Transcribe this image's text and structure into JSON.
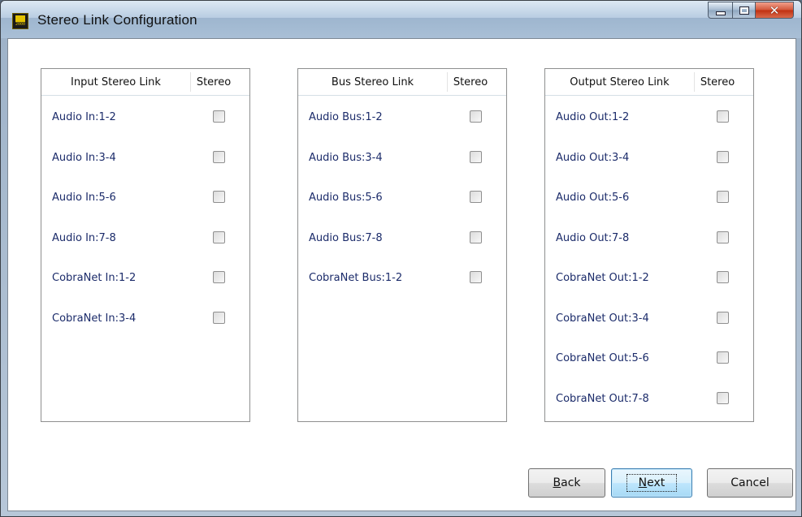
{
  "window": {
    "title": "Stereo Link Configuration",
    "icon_name": "app-logo-icon",
    "accent_color": "#1b2b6a"
  },
  "panels": [
    {
      "header": "Input Stereo Link",
      "stereo_header": "Stereo",
      "rows": [
        {
          "label": "Audio In:1-2",
          "checked": false
        },
        {
          "label": "Audio In:3-4",
          "checked": false
        },
        {
          "label": "Audio In:5-6",
          "checked": false
        },
        {
          "label": "Audio In:7-8",
          "checked": false
        },
        {
          "label": "CobraNet In:1-2",
          "checked": false
        },
        {
          "label": "CobraNet In:3-4",
          "checked": false
        }
      ]
    },
    {
      "header": "Bus Stereo Link",
      "stereo_header": "Stereo",
      "rows": [
        {
          "label": "Audio Bus:1-2",
          "checked": false
        },
        {
          "label": "Audio Bus:3-4",
          "checked": false
        },
        {
          "label": "Audio Bus:5-6",
          "checked": false
        },
        {
          "label": "Audio Bus:7-8",
          "checked": false
        },
        {
          "label": "CobraNet Bus:1-2",
          "checked": false
        }
      ]
    },
    {
      "header": "Output Stereo Link",
      "stereo_header": "Stereo",
      "rows": [
        {
          "label": "Audio Out:1-2",
          "checked": false
        },
        {
          "label": "Audio Out:3-4",
          "checked": false
        },
        {
          "label": "Audio Out:5-6",
          "checked": false
        },
        {
          "label": "Audio Out:7-8",
          "checked": false
        },
        {
          "label": "CobraNet Out:1-2",
          "checked": false
        },
        {
          "label": "CobraNet Out:3-4",
          "checked": false
        },
        {
          "label": "CobraNet Out:5-6",
          "checked": false
        },
        {
          "label": "CobraNet Out:7-8",
          "checked": false
        }
      ]
    }
  ],
  "buttons": {
    "back": {
      "mnemonic": "B",
      "rest": "ack"
    },
    "next": {
      "mnemonic": "N",
      "rest": "ext"
    },
    "cancel": {
      "label": "Cancel"
    }
  }
}
